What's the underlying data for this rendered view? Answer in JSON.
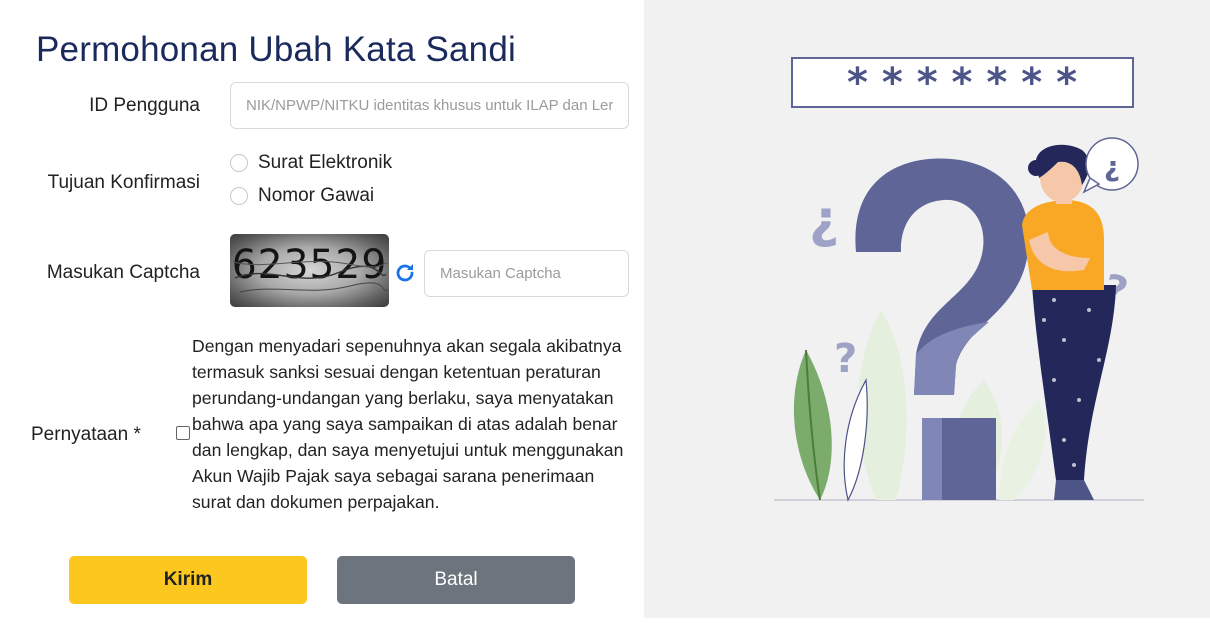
{
  "page": {
    "title": "Permohonan Ubah Kata Sandi"
  },
  "form": {
    "id_label": "ID Pengguna",
    "id_placeholder": "NIK/NPWP/NITKU identitas khusus untuk ILAP dan Ler",
    "confirm_label": "Tujuan Konfirmasi",
    "confirm_options": [
      "Surat Elektronik",
      "Nomor Gawai"
    ],
    "captcha_label": "Masukan Captcha",
    "captcha_text": "623529",
    "captcha_placeholder": "Masukan Captcha",
    "statement_label": "Pernyataan *",
    "statement_text": "Dengan menyadari sepenuhnya akan segala akibatnya termasuk sanksi sesuai dengan ketentuan peraturan perundang-undangan yang berlaku, saya menyatakan bahwa apa yang saya sampaikan di atas adalah benar dan lengkap, dan saya menyetujui untuk menggunakan Akun Wajib Pajak saya sebagai sarana penerimaan surat dan dokumen perpajakan."
  },
  "buttons": {
    "submit": "Kirim",
    "cancel": "Batal"
  },
  "illustration": {
    "password_mask": "* * * * * * *",
    "bubble_glyph": "¿"
  },
  "colors": {
    "accent": "#fcc81f",
    "title": "#1b2a5c",
    "cancel": "#6c757d",
    "illustration": "#5f6596"
  }
}
